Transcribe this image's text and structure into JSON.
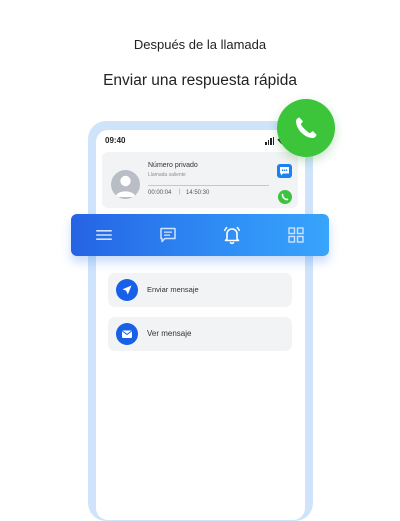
{
  "header": {
    "subtitle": "Después de la llamada",
    "title": "Enviar una respuesta rápida"
  },
  "status_bar": {
    "time": "09:40"
  },
  "call_card": {
    "caller_name": "Número privado",
    "call_type": "Llamada saliente",
    "duration": "00:00:04",
    "separator": "|",
    "time": "14:50:30"
  },
  "bottom_nav": {
    "items": [
      "menu-icon",
      "chat-icon",
      "bell-icon",
      "grid-icon"
    ],
    "active": "bell-icon"
  },
  "actions": {
    "send_message": "Enviar mensaje",
    "view_message": "Ver mensaje"
  },
  "colors": {
    "accent_blue": "#1860e8",
    "call_green": "#3cc43a",
    "nav_gradient_start": "#2563e4",
    "nav_gradient_end": "#38a4fb"
  }
}
